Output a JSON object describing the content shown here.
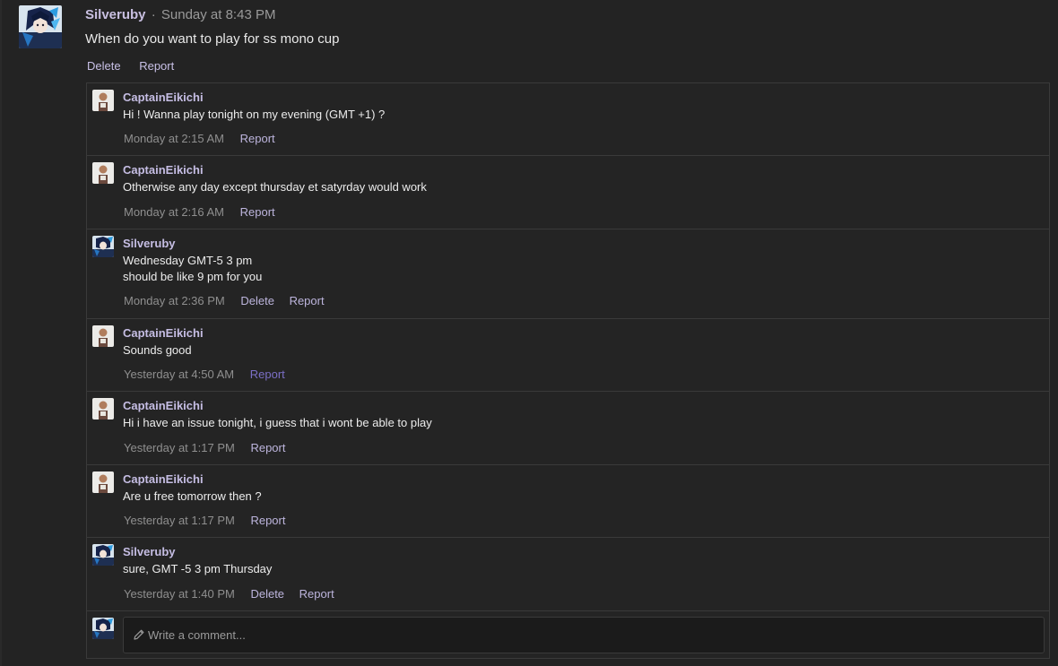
{
  "post": {
    "author": "Silveruby",
    "separator": "·",
    "time": "Sunday at 8:43 PM",
    "body": "When do you want to play for ss mono cup",
    "actions": {
      "delete": "Delete",
      "report": "Report"
    }
  },
  "comments": [
    {
      "author": "CaptainEikichi",
      "lines": [
        "Hi ! Wanna play tonight on my evening (GMT +1) ?"
      ],
      "time": "Monday at 2:15 AM",
      "delete": "",
      "report": "Report",
      "avatar": "captain-avatar"
    },
    {
      "author": "CaptainEikichi",
      "lines": [
        "Otherwise any day except thursday et satyrday would work"
      ],
      "time": "Monday at 2:16 AM",
      "delete": "",
      "report": "Report",
      "avatar": "captain-avatar"
    },
    {
      "author": "Silveruby",
      "lines": [
        "Wednesday GMT-5 3 pm",
        "should be like 9 pm for you"
      ],
      "time": "Monday at 2:36 PM",
      "delete": "Delete",
      "report": "Report",
      "avatar": "silveruby-avatar"
    },
    {
      "author": "CaptainEikichi",
      "lines": [
        "Sounds good"
      ],
      "time": "Yesterday at 4:50 AM",
      "delete": "",
      "report": "Report",
      "avatar": "captain-avatar",
      "report_hover": true
    },
    {
      "author": "CaptainEikichi",
      "lines": [
        "Hi i have an issue tonight, i guess that i wont be able to play"
      ],
      "time": "Yesterday at 1:17 PM",
      "delete": "",
      "report": "Report",
      "avatar": "captain-avatar"
    },
    {
      "author": "CaptainEikichi",
      "lines": [
        "Are u free tomorrow then ?"
      ],
      "time": "Yesterday at 1:17 PM",
      "delete": "",
      "report": "Report",
      "avatar": "captain-avatar"
    },
    {
      "author": "Silveruby",
      "lines": [
        "sure, GMT -5 3 pm Thursday"
      ],
      "time": "Yesterday at 1:40 PM",
      "delete": "Delete",
      "report": "Report",
      "avatar": "silveruby-avatar"
    }
  ],
  "composer": {
    "placeholder": "Write a comment...",
    "icon": "pencil-icon"
  },
  "colors": {
    "background": "#232323",
    "author": "#c5bde3",
    "link": "#bdb5dd",
    "link_hover": "#7b6fc6",
    "muted": "#8f8f8f",
    "text": "#ececec"
  }
}
